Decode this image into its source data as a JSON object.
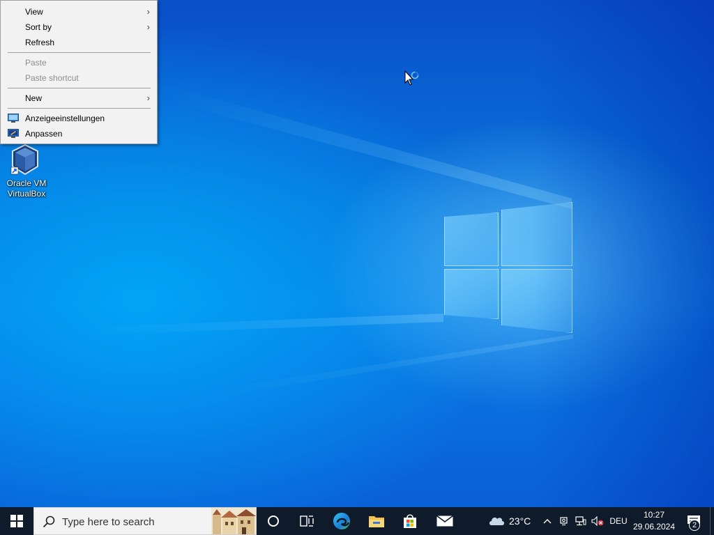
{
  "context_menu": {
    "items": [
      {
        "label": "View",
        "submenu": true,
        "disabled": false
      },
      {
        "label": "Sort by",
        "submenu": true,
        "disabled": false
      },
      {
        "label": "Refresh",
        "submenu": false,
        "disabled": false
      },
      {
        "label": "Paste",
        "submenu": false,
        "disabled": true
      },
      {
        "label": "Paste shortcut",
        "submenu": false,
        "disabled": true
      },
      {
        "label": "New",
        "submenu": true,
        "disabled": false
      },
      {
        "label": "Anzeigeeinstellungen",
        "icon": "display-settings-icon",
        "disabled": false
      },
      {
        "label": "Anpassen",
        "icon": "personalize-icon",
        "disabled": false
      }
    ],
    "submenu_arrow": "›"
  },
  "desktop": {
    "shortcuts": [
      {
        "label_line1": "Oracle VM",
        "label_line2": "VirtualBox",
        "icon": "virtualbox-icon"
      }
    ]
  },
  "taskbar": {
    "search_placeholder": "Type here to search",
    "pinned": [
      "cortana-icon",
      "task-view-icon",
      "edge-icon",
      "file-explorer-icon",
      "store-icon",
      "mail-icon"
    ],
    "weather": {
      "temp": "23°C",
      "icon": "cloud-icon"
    },
    "tray": {
      "language": "DEU"
    },
    "clock": {
      "time": "10:27",
      "date": "29.06.2024"
    },
    "notifications": {
      "count": "2"
    }
  },
  "colors": {
    "taskbar_bg": "#0f1b2b",
    "desktop_blue": "#0a7ee6",
    "menu_bg": "#f2f2f2"
  }
}
